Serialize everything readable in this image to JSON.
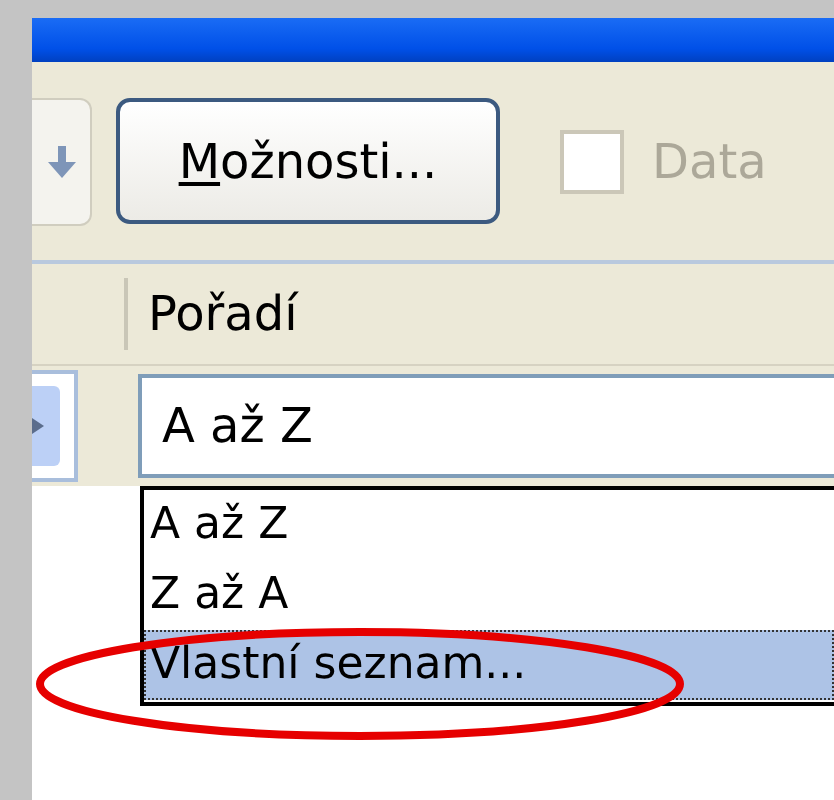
{
  "toolbar": {
    "options_button": {
      "mnemonic": "M",
      "label_rest": "ožnosti..."
    },
    "header_checkbox": {
      "label": "Data",
      "checked": false,
      "disabled": true
    }
  },
  "columns": [
    {
      "label": "Pořadí"
    }
  ],
  "order_combo": {
    "value": "A až Z"
  },
  "order_dropdown": {
    "items": [
      {
        "label": "A až Z",
        "selected": false
      },
      {
        "label": "Z až A",
        "selected": false
      },
      {
        "label": "Vlastní seznam...",
        "selected": true,
        "circled": true
      }
    ]
  }
}
